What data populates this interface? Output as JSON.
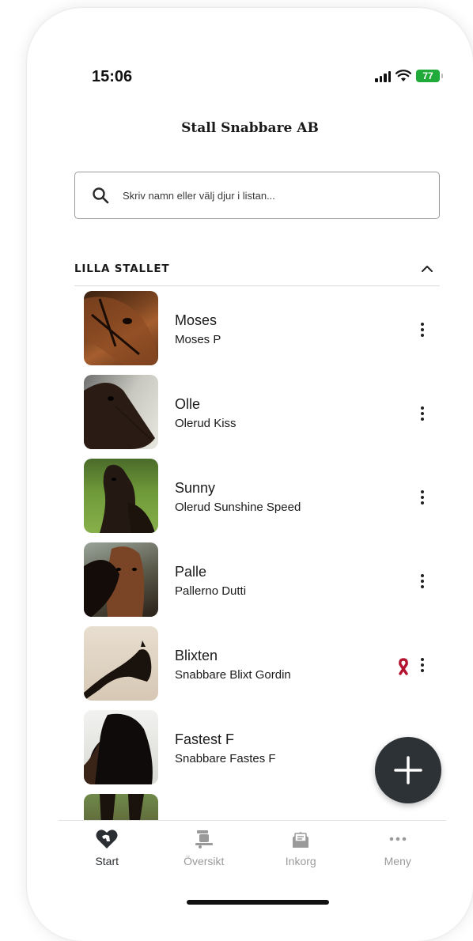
{
  "status": {
    "time": "15:06",
    "battery": "77"
  },
  "header": {
    "title": "Stall Snabbare AB"
  },
  "search": {
    "placeholder": "Skriv namn eller välj djur i listan..."
  },
  "section": {
    "title": "LILLA STALLET"
  },
  "horses": [
    {
      "name": "Moses",
      "registered_name": "Moses P"
    },
    {
      "name": "Olle",
      "registered_name": "Olerud Kiss"
    },
    {
      "name": "Sunny",
      "registered_name": "Olerud Sunshine Speed"
    },
    {
      "name": "Palle",
      "registered_name": "Pallerno Dutti"
    },
    {
      "name": "Blixten",
      "registered_name": "Snabbare Blixt Gordin"
    },
    {
      "name": "Fastest F",
      "registered_name": "Snabbare Fastes F"
    }
  ],
  "tabs": [
    {
      "label": "Start",
      "icon": "horse-heart-icon",
      "active": true
    },
    {
      "label": "Översikt",
      "icon": "horse-trailer-icon",
      "active": false
    },
    {
      "label": "Inkorg",
      "icon": "envelope-icon",
      "active": false
    },
    {
      "label": "Meny",
      "icon": "more-dots-icon",
      "active": false
    }
  ],
  "colors": {
    "fab": "#2d3237",
    "ribbon": "#b3132f",
    "active_tab": "#2b2f33",
    "inactive_tab": "#9a9a9a",
    "battery": "#1faa3a"
  }
}
